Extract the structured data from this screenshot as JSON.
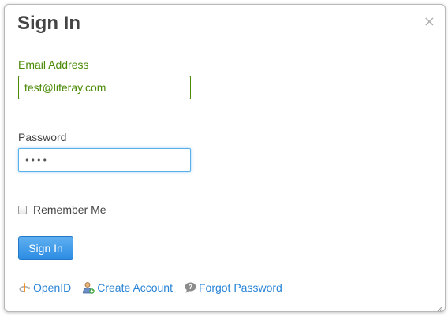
{
  "dialog": {
    "title": "Sign In",
    "close_glyph": "×"
  },
  "form": {
    "email": {
      "label": "Email Address",
      "value": "test@liferay.com",
      "state": "valid"
    },
    "password": {
      "label": "Password",
      "masked_value": "••••",
      "state": "focused"
    },
    "remember_me": {
      "label": "Remember Me",
      "checked": false
    },
    "submit_label": "Sign In"
  },
  "links": {
    "openid": {
      "label": "OpenID",
      "icon": "openid-icon"
    },
    "create_account": {
      "label": "Create Account",
      "icon": "add-user-icon"
    },
    "forgot_password": {
      "label": "Forgot Password",
      "icon": "speech-bubble-icon"
    }
  },
  "colors": {
    "valid": "#4a8a05",
    "focus": "#5ab0e8",
    "primary": "#2c8ce3",
    "link": "#2a84d6"
  }
}
